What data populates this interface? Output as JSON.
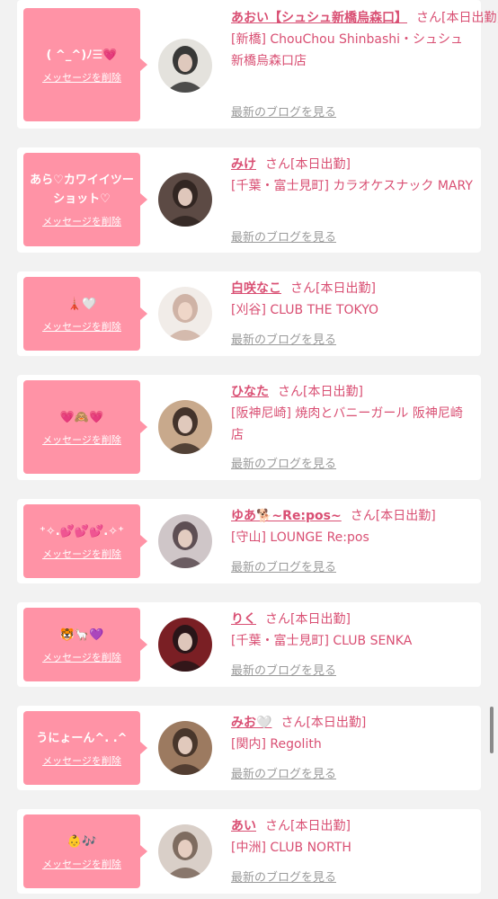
{
  "entries": [
    {
      "name": "あおい【シュシュ新橋烏森口】",
      "san": "さん",
      "status": "[本日出勤]",
      "area": "[新橋]",
      "shop": "ChouChou Shinbashi・シュシュ新橋烏森口店",
      "message": "( ^_^)ﾉ☰💗",
      "delete_label": "メッセージを削除",
      "blog_label": "最新のブログを見る",
      "avatar_colors": [
        "#e4e2dd",
        "#1a1a1a"
      ]
    },
    {
      "name": "みけ",
      "san": "さん",
      "status": "[本日出勤]",
      "area": "[千葉・富士見町]",
      "shop": "カラオケスナック MARY",
      "message": "あら♡カワイイツーショット♡",
      "delete_label": "メッセージを削除",
      "blog_label": "最新のブログを見る",
      "avatar_colors": [
        "#5c4a44",
        "#2a201c"
      ]
    },
    {
      "name": "白咲なこ",
      "san": "さん",
      "status": "[本日出勤]",
      "area": "[刈谷]",
      "shop": "CLUB THE TOKYO",
      "message": "🗼🤍",
      "delete_label": "メッセージを削除",
      "blog_label": "最新のブログを見る",
      "avatar_colors": [
        "#f1ece8",
        "#c9a99a"
      ]
    },
    {
      "name": "ひなた",
      "san": "さん",
      "status": "[本日出勤]",
      "area": "[阪神尼崎]",
      "shop": "焼肉とバニーガール 阪神尼崎店",
      "message": "💗🙈💗",
      "delete_label": "メッセージを削除",
      "blog_label": "最新のブログを見る",
      "avatar_colors": [
        "#c8a98c",
        "#2b1f1a"
      ]
    },
    {
      "name": "ゆあ🐕~Re:pos~",
      "san": "さん",
      "status": "[本日出勤]",
      "area": "[守山]",
      "shop": "LOUNGE Re:pos",
      "message": "⁺✧.💕💕💕.✧⁺",
      "delete_label": "メッセージを削除",
      "blog_label": "最新のブログを見る",
      "avatar_colors": [
        "#cfc6c8",
        "#4a3a40"
      ]
    },
    {
      "name": "りく",
      "san": "さん",
      "status": "[本日出勤]",
      "area": "[千葉・富士見町]",
      "shop": "CLUB SENKA",
      "message": "🐯🦙💜",
      "delete_label": "メッセージを削除",
      "blog_label": "最新のブログを見る",
      "avatar_colors": [
        "#7a1f24",
        "#1b1416"
      ]
    },
    {
      "name": "みお🤍",
      "san": "さん",
      "status": "[本日出勤]",
      "area": "[関内]",
      "shop": "Regolith",
      "message": "うにょーん^. .^",
      "delete_label": "メッセージを削除",
      "blog_label": "最新のブログを見る",
      "avatar_colors": [
        "#9c7a60",
        "#3a2a22"
      ]
    },
    {
      "name": "あい",
      "san": "さん",
      "status": "[本日出勤]",
      "area": "[中洲]",
      "shop": "CLUB NORTH",
      "message": "👶🎶",
      "delete_label": "メッセージを削除",
      "blog_label": "最新のブログを見る",
      "avatar_colors": [
        "#d9cfc8",
        "#6d5a4d"
      ]
    }
  ]
}
